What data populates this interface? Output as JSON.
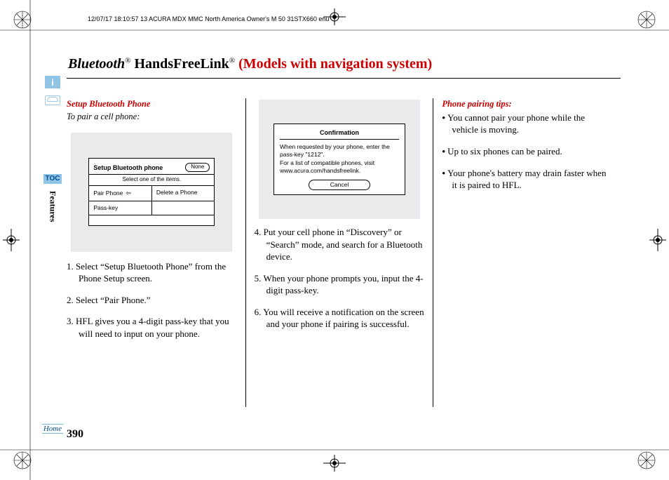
{
  "meta": {
    "header": "12/07/17 18:10:57   13 ACURA MDX MMC North America Owner's M 50 31STX660 enu"
  },
  "title": {
    "bt": "Bluetooth",
    "hfl": " HandsFreeLink",
    "model": " (Models with navigation system)"
  },
  "sidebar": {
    "toc": "TOC",
    "features": "Features",
    "home": "Home"
  },
  "col1": {
    "heading": "Setup Bluetooth Phone",
    "sub": "To pair a cell phone:",
    "screen": {
      "title": "Setup Bluetooth phone",
      "none": "None",
      "sub": "Select one of the items.",
      "c1": "Pair Phone",
      "c2": "Delete a Phone",
      "c3": "Pass-key"
    },
    "steps": [
      "Select “Setup Bluetooth Phone” from the Phone Setup screen.",
      "Select “Pair Phone.”",
      "HFL gives you a 4-digit pass-key that you will need to input on your phone."
    ]
  },
  "col2": {
    "screen": {
      "title": "Confirmation",
      "body1": "When requested by your phone, enter the pass-key \"1212\".",
      "body2": "For a list of compatible phones, visit www.acura.com/handsfreelink.",
      "cancel": "Cancel"
    },
    "steps": [
      "Put your cell phone in “Discovery” or “Search” mode, and search for a Bluetooth device.",
      "When your phone prompts you, input the 4-digit pass-key.",
      "You will receive a notification on the screen and your phone if pairing is successful."
    ]
  },
  "col3": {
    "heading": "Phone pairing tips:",
    "tips": [
      "You cannot pair your phone while the vehicle is moving.",
      "Up to six phones can be paired.",
      "Your phone's battery may drain faster when it is paired to HFL."
    ]
  },
  "page_number": "390"
}
